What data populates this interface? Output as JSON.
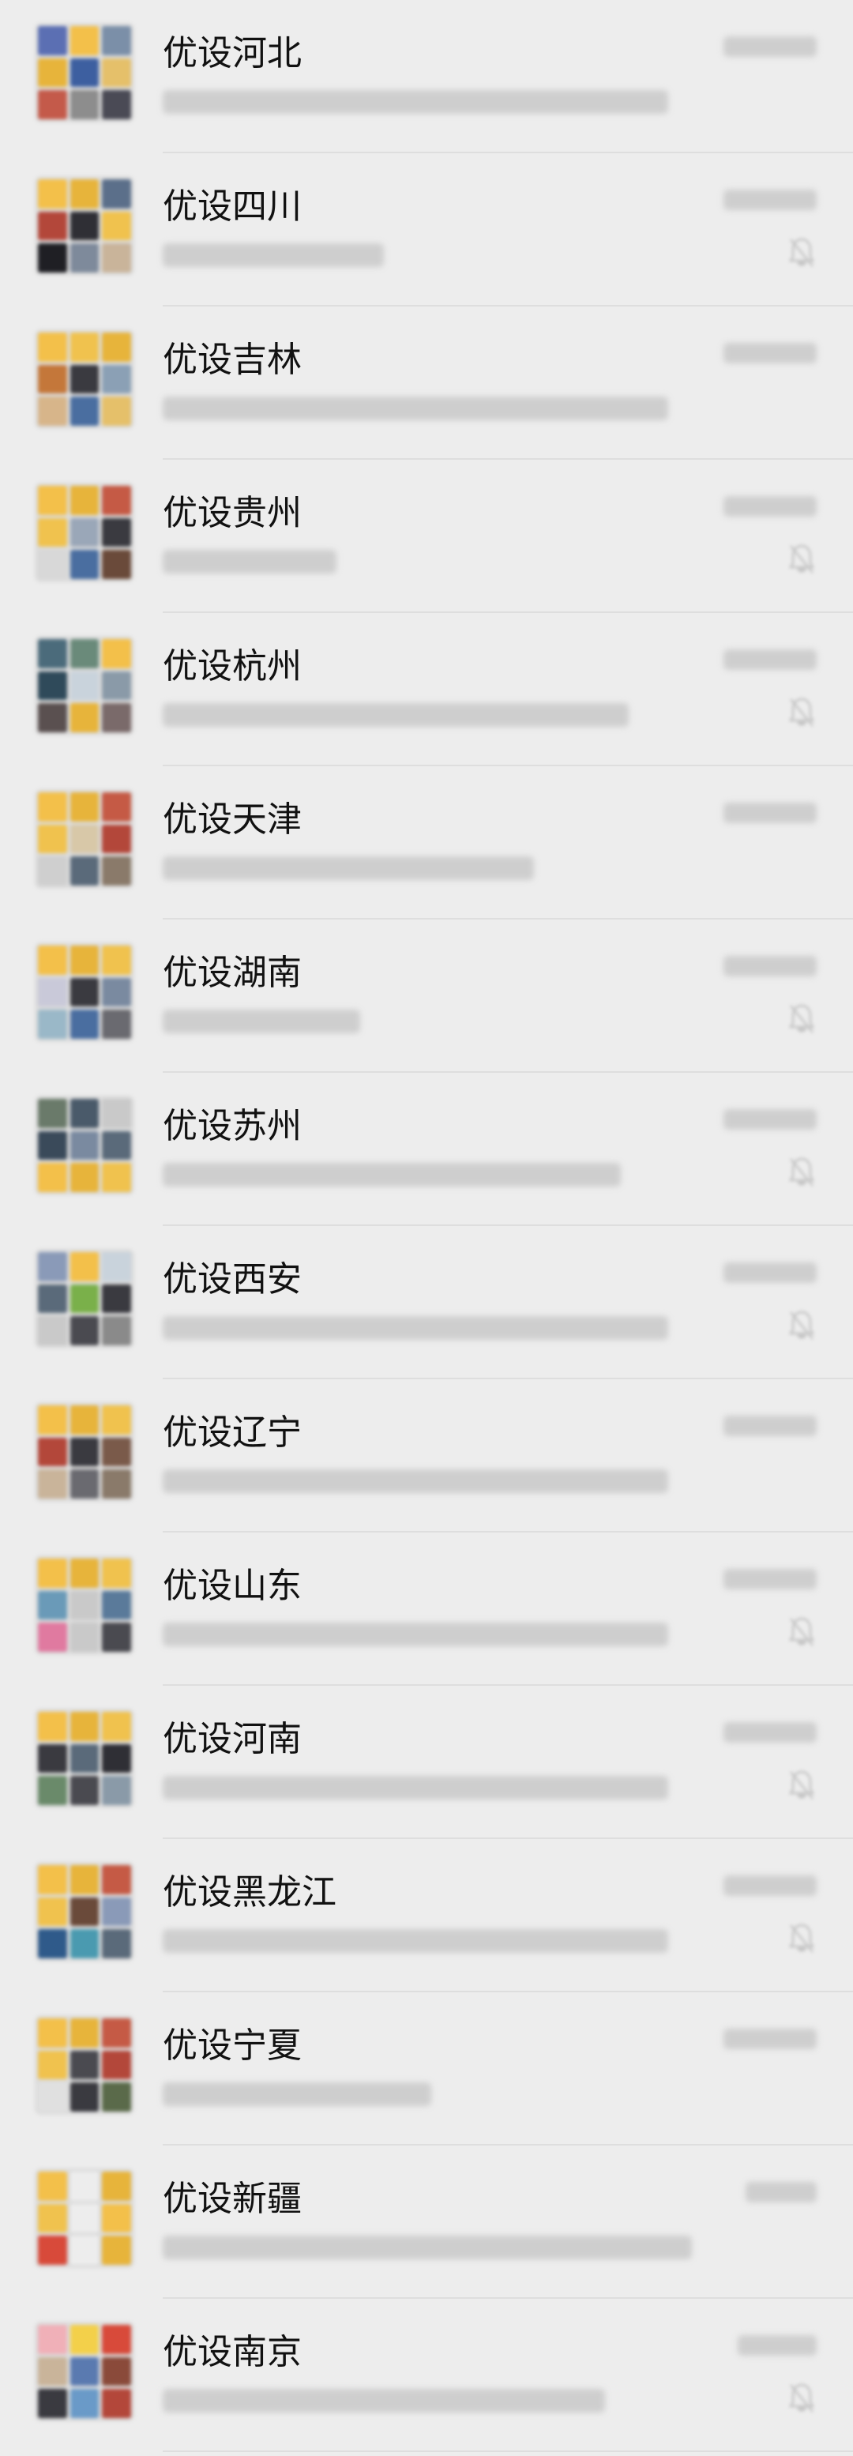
{
  "colors": {
    "background": "#ededed",
    "title_text": "#111111",
    "divider": "#dedede"
  },
  "chats": [
    {
      "name": "优设河北",
      "muted": false,
      "avatar_icon": "group-avatar-icon",
      "avatar_colors": [
        "#5b6fb3",
        "#f3c04a",
        "#7b8fa8",
        "#e7b43b",
        "#3d5fa0",
        "#e5c06a",
        "#c45a4a",
        "#8d8d8d",
        "#4a4a55"
      ]
    },
    {
      "name": "优设四川",
      "muted": true,
      "avatar_icon": "group-avatar-icon",
      "avatar_colors": [
        "#f3c04a",
        "#e7b43b",
        "#5b6f8a",
        "#b3473a",
        "#2f2f35",
        "#f0c24e",
        "#1f1f24",
        "#7e8a9b",
        "#c9b49a"
      ]
    },
    {
      "name": "优设吉林",
      "muted": false,
      "avatar_icon": "group-avatar-icon",
      "avatar_colors": [
        "#f3c04a",
        "#f0c24e",
        "#e7b43b",
        "#c4773a",
        "#3a3a40",
        "#8ba0b5",
        "#d7b58a",
        "#4a6ea0",
        "#e5c06a"
      ]
    },
    {
      "name": "优设贵州",
      "muted": true,
      "avatar_icon": "group-avatar-icon",
      "avatar_colors": [
        "#f3c04a",
        "#e7b43b",
        "#c55a45",
        "#f0c24e",
        "#9aa7b8",
        "#3a3a40",
        "#d8d8d8",
        "#4a6ea0",
        "#6a4a3a"
      ]
    },
    {
      "name": "优设杭州",
      "muted": true,
      "avatar_icon": "group-avatar-icon",
      "avatar_colors": [
        "#4b6b7b",
        "#6a8a7a",
        "#f3c04a",
        "#2f4a5a",
        "#c9d3dc",
        "#8a9aa8",
        "#5a5050",
        "#e7b43b",
        "#7a6a6a"
      ]
    },
    {
      "name": "优设天津",
      "muted": false,
      "avatar_icon": "group-avatar-icon",
      "avatar_colors": [
        "#f3c04a",
        "#e7b43b",
        "#c55a45",
        "#f0c24e",
        "#d8c8a8",
        "#b3473a",
        "#cfcfcf",
        "#5a6a7a",
        "#8a7a6a"
      ]
    },
    {
      "name": "优设湖南",
      "muted": true,
      "avatar_icon": "group-avatar-icon",
      "avatar_colors": [
        "#f3c04a",
        "#e7b43b",
        "#f0c24e",
        "#c9c9d9",
        "#3a3a40",
        "#7a8aa0",
        "#9ab8c8",
        "#4a6ea0",
        "#6a6a70"
      ]
    },
    {
      "name": "优设苏州",
      "muted": true,
      "avatar_icon": "group-avatar-icon",
      "avatar_colors": [
        "#6a7a6a",
        "#4a5a6a",
        "#c9c9c9",
        "#3a4a5a",
        "#7a8aa0",
        "#5a6a7a",
        "#f3c04a",
        "#e7b43b",
        "#f0c24e"
      ]
    },
    {
      "name": "优设西安",
      "muted": true,
      "avatar_icon": "group-avatar-icon",
      "avatar_colors": [
        "#8a9ab8",
        "#f3c04a",
        "#c9d3dc",
        "#5a6a7a",
        "#7ab04a",
        "#3a3a40",
        "#c9c9c9",
        "#4a4a50",
        "#8a8a8a"
      ]
    },
    {
      "name": "优设辽宁",
      "muted": false,
      "avatar_icon": "group-avatar-icon",
      "avatar_colors": [
        "#f3c04a",
        "#e7b43b",
        "#f0c24e",
        "#b3473a",
        "#3a3a40",
        "#7a5a4a",
        "#c9b49a",
        "#6a6a70",
        "#8a7a6a"
      ]
    },
    {
      "name": "优设山东",
      "muted": true,
      "avatar_icon": "group-avatar-icon",
      "avatar_colors": [
        "#f3c04a",
        "#e7b43b",
        "#f0c24e",
        "#6a9ab8",
        "#c9c9c9",
        "#5a7a9a",
        "#e07aa0",
        "#c9c9c9",
        "#4a4a50"
      ]
    },
    {
      "name": "优设河南",
      "muted": true,
      "avatar_icon": "group-avatar-icon",
      "avatar_colors": [
        "#f3c04a",
        "#e7b43b",
        "#f0c24e",
        "#3a3a40",
        "#5a6a7a",
        "#2f2f35",
        "#6a8a6a",
        "#4a4a50",
        "#8a9aa8"
      ]
    },
    {
      "name": "优设黑龙江",
      "muted": true,
      "avatar_icon": "group-avatar-icon",
      "avatar_colors": [
        "#f3c04a",
        "#e7b43b",
        "#c55a45",
        "#f0c24e",
        "#6a4a3a",
        "#8a9ab8",
        "#2f5a8a",
        "#4a9ab0",
        "#5a6a7a"
      ]
    },
    {
      "name": "优设宁夏",
      "muted": false,
      "avatar_icon": "group-avatar-icon",
      "avatar_colors": [
        "#f3c04a",
        "#e7b43b",
        "#c55a45",
        "#f0c24e",
        "#4a4a50",
        "#b3473a",
        "#e0e0e0",
        "#3a3a40",
        "#5a6a4a"
      ]
    },
    {
      "name": "优设新疆",
      "muted": false,
      "avatar_icon": "group-avatar-icon",
      "avatar_colors": [
        "#f3c04a",
        "#ededed",
        "#e7b43b",
        "#f0c24e",
        "#ededed",
        "#f3c04a",
        "#d84a3a",
        "#ededed",
        "#e7b43b"
      ]
    },
    {
      "name": "优设南京",
      "muted": true,
      "avatar_icon": "group-avatar-icon",
      "avatar_colors": [
        "#f0b0b8",
        "#f3d04a",
        "#d84a3a",
        "#c9b49a",
        "#5a7ab0",
        "#8a4a3a",
        "#3a3a40",
        "#6a9ac8",
        "#b3473a"
      ]
    }
  ]
}
